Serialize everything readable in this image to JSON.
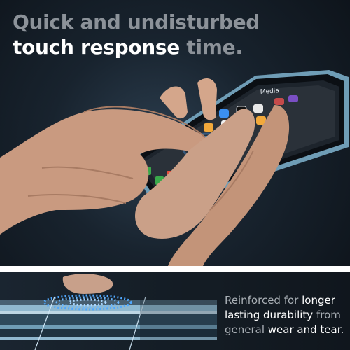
{
  "headline": {
    "line1": "Quick and undisturbed",
    "line2_strong": "touch response",
    "line2_rest": " time."
  },
  "phone_screen": {
    "folder_label": "Media"
  },
  "caption": {
    "line1_muted": "Reinforced for ",
    "line1_strong": "longer",
    "line2_strong": "lasting durability",
    "line2_muted": " from",
    "line3_muted": "general ",
    "line3_strong": "wear and tear."
  },
  "colors": {
    "background_dark": "#18232e",
    "accent_blue": "#4fa8ff",
    "phone_frame": "#8fb8cf",
    "muted_text": "#8c9299"
  }
}
